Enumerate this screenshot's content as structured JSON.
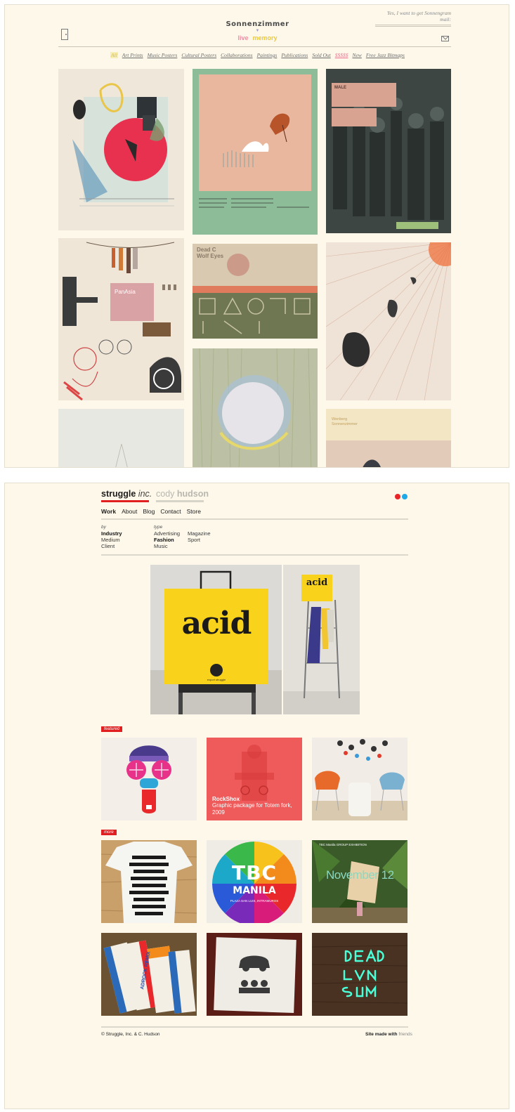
{
  "sonnenzimmer": {
    "logo": "Sonnenzimmer",
    "subnav": {
      "live": "live",
      "memory": "memory"
    },
    "mailing_prompt": "Yes, I want to get Sonnengram mail:",
    "nav": [
      {
        "label": "All"
      },
      {
        "label": "Art Prints"
      },
      {
        "label": "Music Posters"
      },
      {
        "label": "Cultural Posters"
      },
      {
        "label": "Collaborations"
      },
      {
        "label": "Paintings"
      },
      {
        "label": "Publications"
      },
      {
        "label": "Sold Out"
      },
      {
        "label": "$$$$$"
      },
      {
        "label": "New"
      },
      {
        "label": "Free Jazz Bitmaps"
      }
    ],
    "cards": {
      "c3_tag": "MALE",
      "c4_tag": "PanAsia",
      "c5_text1": "Dead C",
      "c5_text2": "Wolf Eyes",
      "c9_text1": "Wenberg",
      "c9_text2": "Sonnenzimmer"
    },
    "colors": {
      "live": "#f28aa4",
      "memory": "#e8c842"
    }
  },
  "struggle": {
    "brand": "struggle",
    "brand_suffix": "inc.",
    "name_first": "cody",
    "name_last": "hudson",
    "nav": [
      {
        "label": "Work"
      },
      {
        "label": "About"
      },
      {
        "label": "Blog"
      },
      {
        "label": "Contact"
      },
      {
        "label": "Store"
      }
    ],
    "filters": {
      "by_label": "by",
      "by": [
        "Industry",
        "Medium",
        "Client"
      ],
      "type_label": "type",
      "type_col1": [
        "Advertising",
        "Fashion",
        "Music"
      ],
      "type_col2": [
        "Magazine",
        "Sport"
      ]
    },
    "hero": {
      "bag_text": "acid",
      "small_bag_text": "acid",
      "bag_logo_text": "export struggle"
    },
    "featured_label": "featured",
    "more_label": "more",
    "featured": [
      {
        "title": "",
        "caption": ""
      },
      {
        "title": "RockShox",
        "caption": "Graphic package for Totem fork, 2009"
      },
      {
        "title": "",
        "caption": ""
      }
    ],
    "tiles": {
      "tbc_big": "TBC",
      "tbc_manila": "MANILA",
      "tbc_sub": "PLAZA SAN LUIS, INTRAMUROS",
      "nov_header": "TBC Manila GROUP EXHIBITION",
      "nov_text": "November 12",
      "adrock": "ADROCK REMIX"
    },
    "footer_left": "© Struggle, Inc. & C. Hudson",
    "footer_right": "Site made with",
    "footer_link": "friends",
    "colors": {
      "accent_red": "#e02020",
      "accent_blue": "#1fa9e8"
    }
  }
}
